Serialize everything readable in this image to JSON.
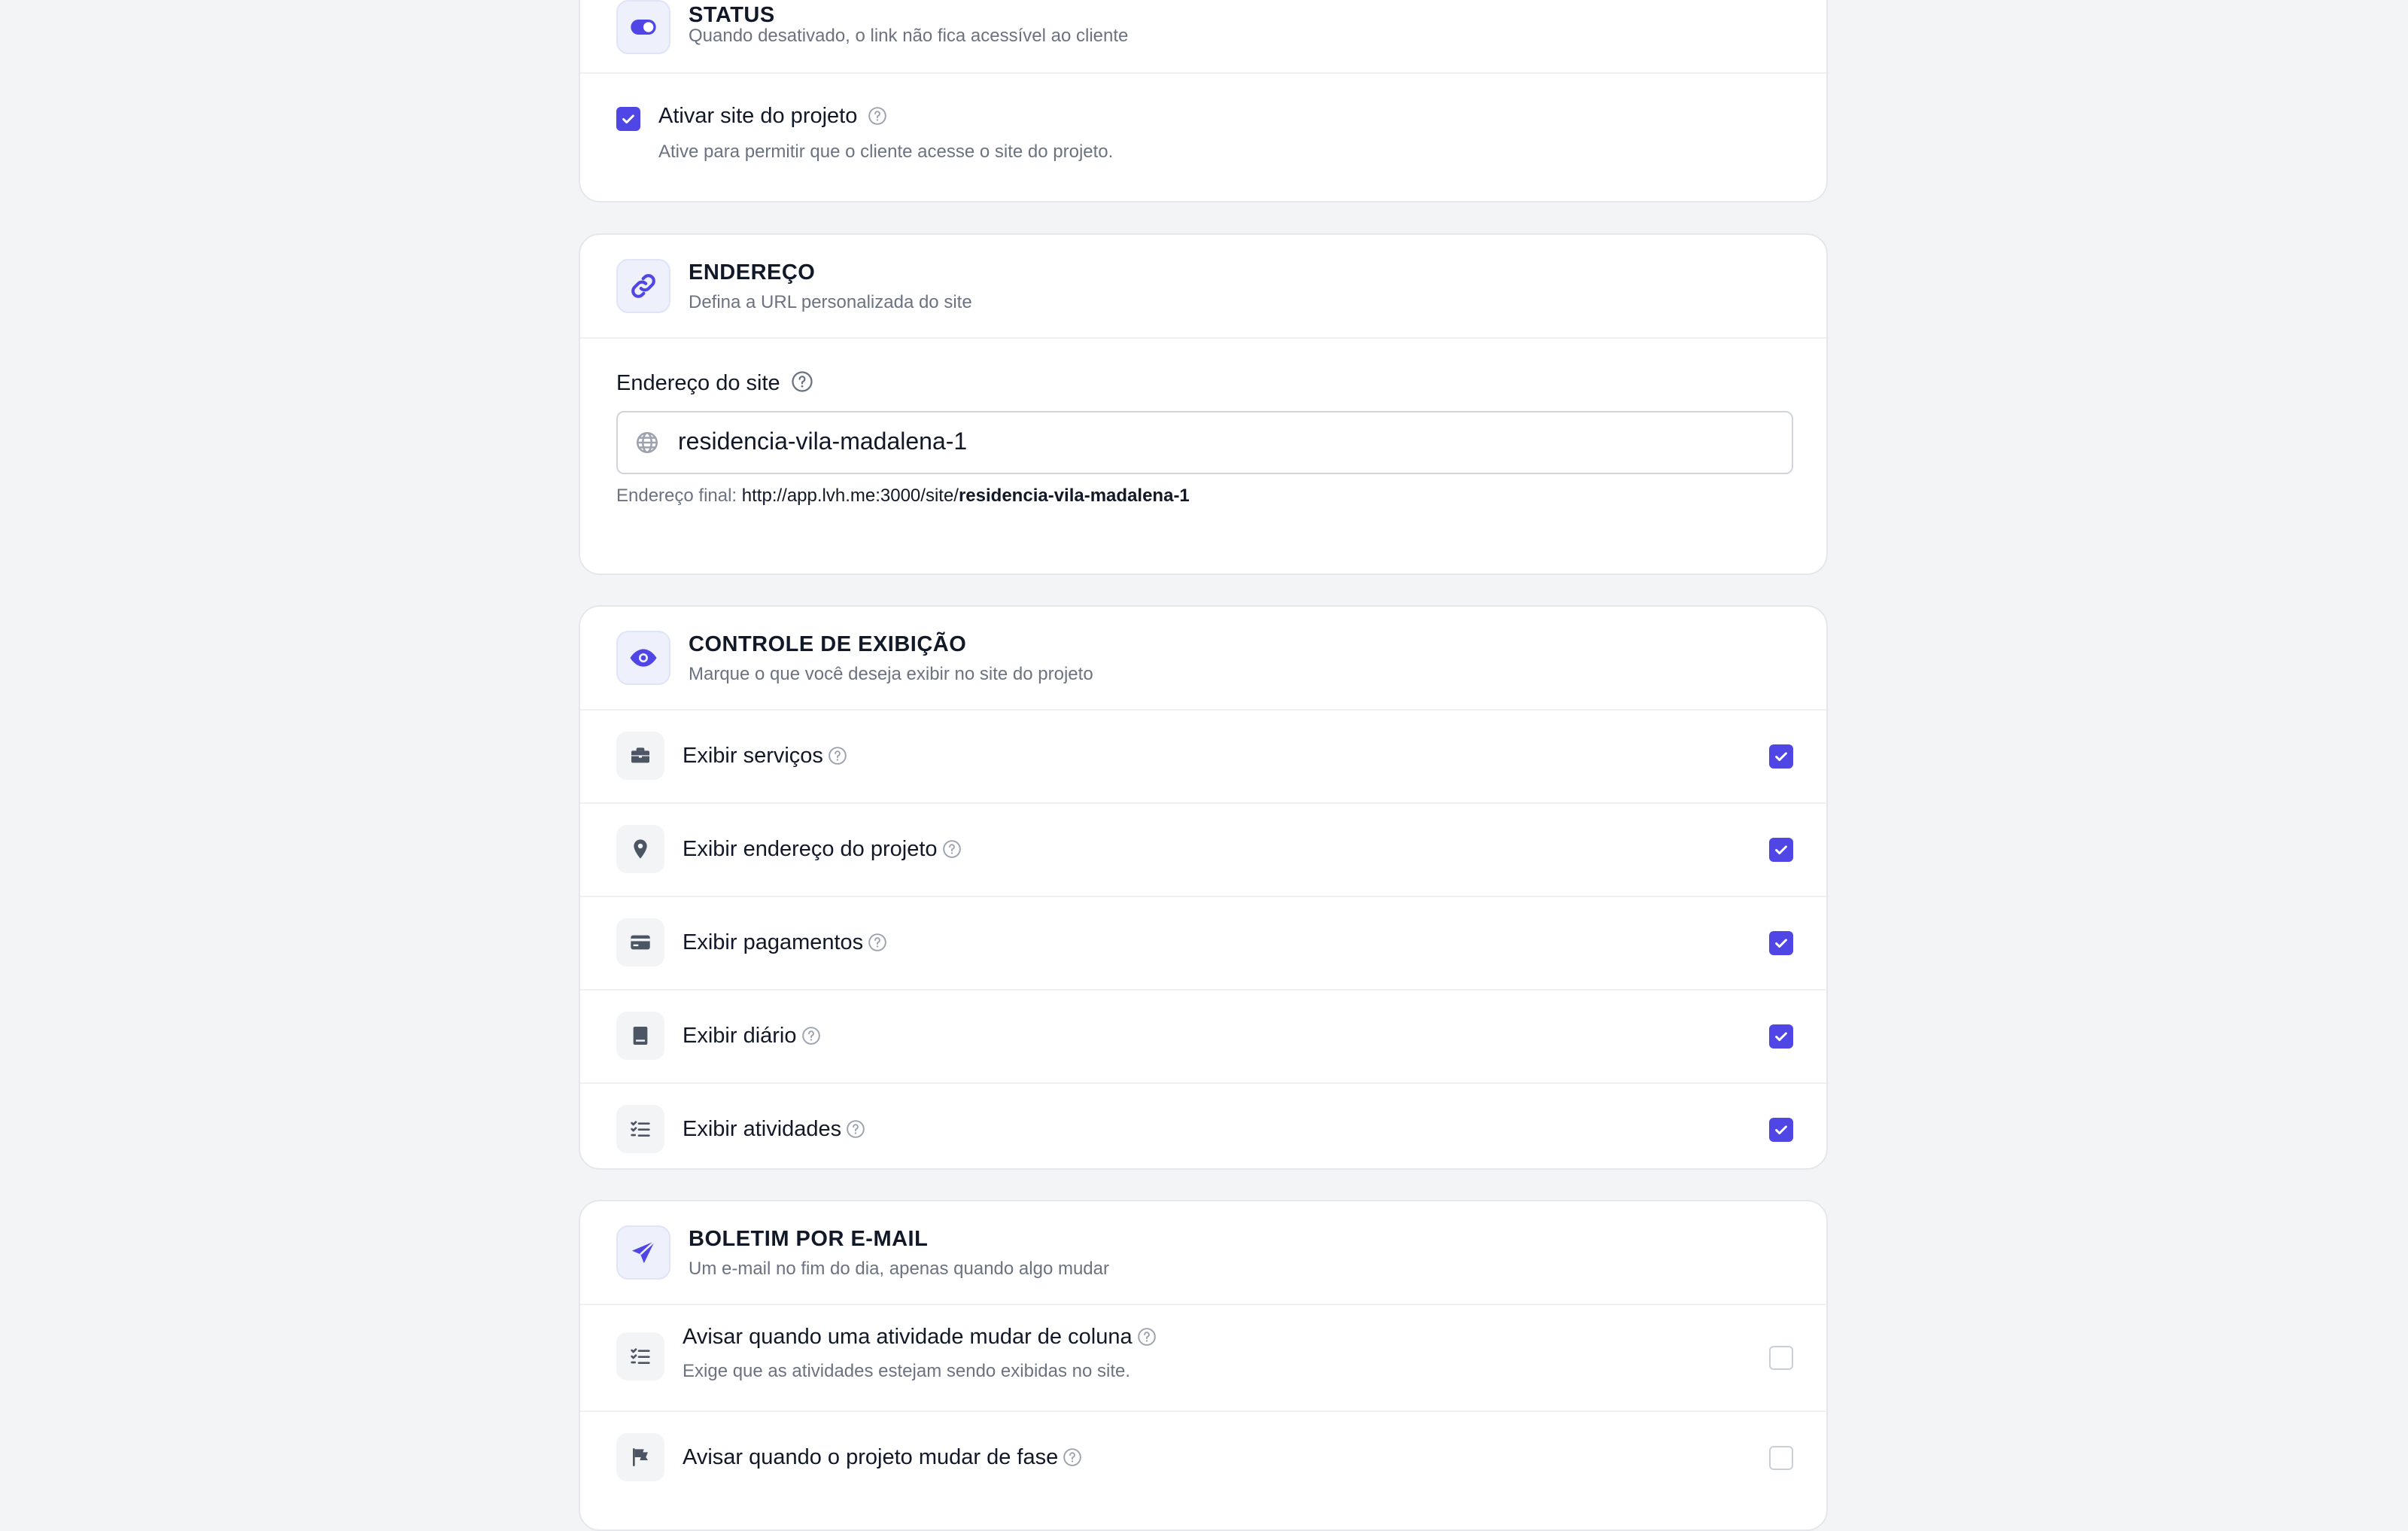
{
  "status_card": {
    "title": "STATUS",
    "subtitle": "Quando desativado, o link não fica acessível ao cliente",
    "checkbox_label": "Ativar site do projeto",
    "checkbox_checked": true,
    "checkbox_hint": "Ative para permitir que o cliente acesse o site do projeto.",
    "icon": "toggle-icon"
  },
  "address_card": {
    "title": "ENDEREÇO",
    "subtitle": "Defina a URL personalizada do site",
    "field_label": "Endereço do site",
    "field_value": "residencia-vila-madalena-1",
    "final_label": "Endereço final:",
    "final_base": "http://app.lvh.me:3000/site/",
    "final_slug": "residencia-vila-madalena-1",
    "icon": "link-icon"
  },
  "display_card": {
    "title": "CONTROLE DE EXIBIÇÃO",
    "subtitle": "Marque o que você deseja exibir no site do projeto",
    "icon": "eye-icon",
    "items": [
      {
        "label": "Exibir serviços",
        "icon": "briefcase-icon",
        "checked": true
      },
      {
        "label": "Exibir endereço do projeto",
        "icon": "map-pin-icon",
        "checked": true
      },
      {
        "label": "Exibir pagamentos",
        "icon": "credit-card-icon",
        "checked": true
      },
      {
        "label": "Exibir diário",
        "icon": "book-icon",
        "checked": true
      },
      {
        "label": "Exibir atividades",
        "icon": "checklist-icon",
        "checked": true
      }
    ]
  },
  "email_card": {
    "title": "BOLETIM POR E-MAIL",
    "subtitle": "Um e-mail no fim do dia, apenas quando algo mudar",
    "icon": "paper-plane-icon",
    "items": [
      {
        "label": "Avisar quando uma atividade mudar de coluna",
        "hint": "Exige que as atividades estejam sendo exibidas no site.",
        "icon": "checklist-icon",
        "checked": false
      },
      {
        "label": "Avisar quando o projeto mudar de fase",
        "icon": "flag-icon",
        "checked": false
      }
    ]
  },
  "colors": {
    "accent": "#4f46e5",
    "background": "#f3f4f6",
    "card": "#ffffff",
    "muted_text": "#6b7280"
  }
}
